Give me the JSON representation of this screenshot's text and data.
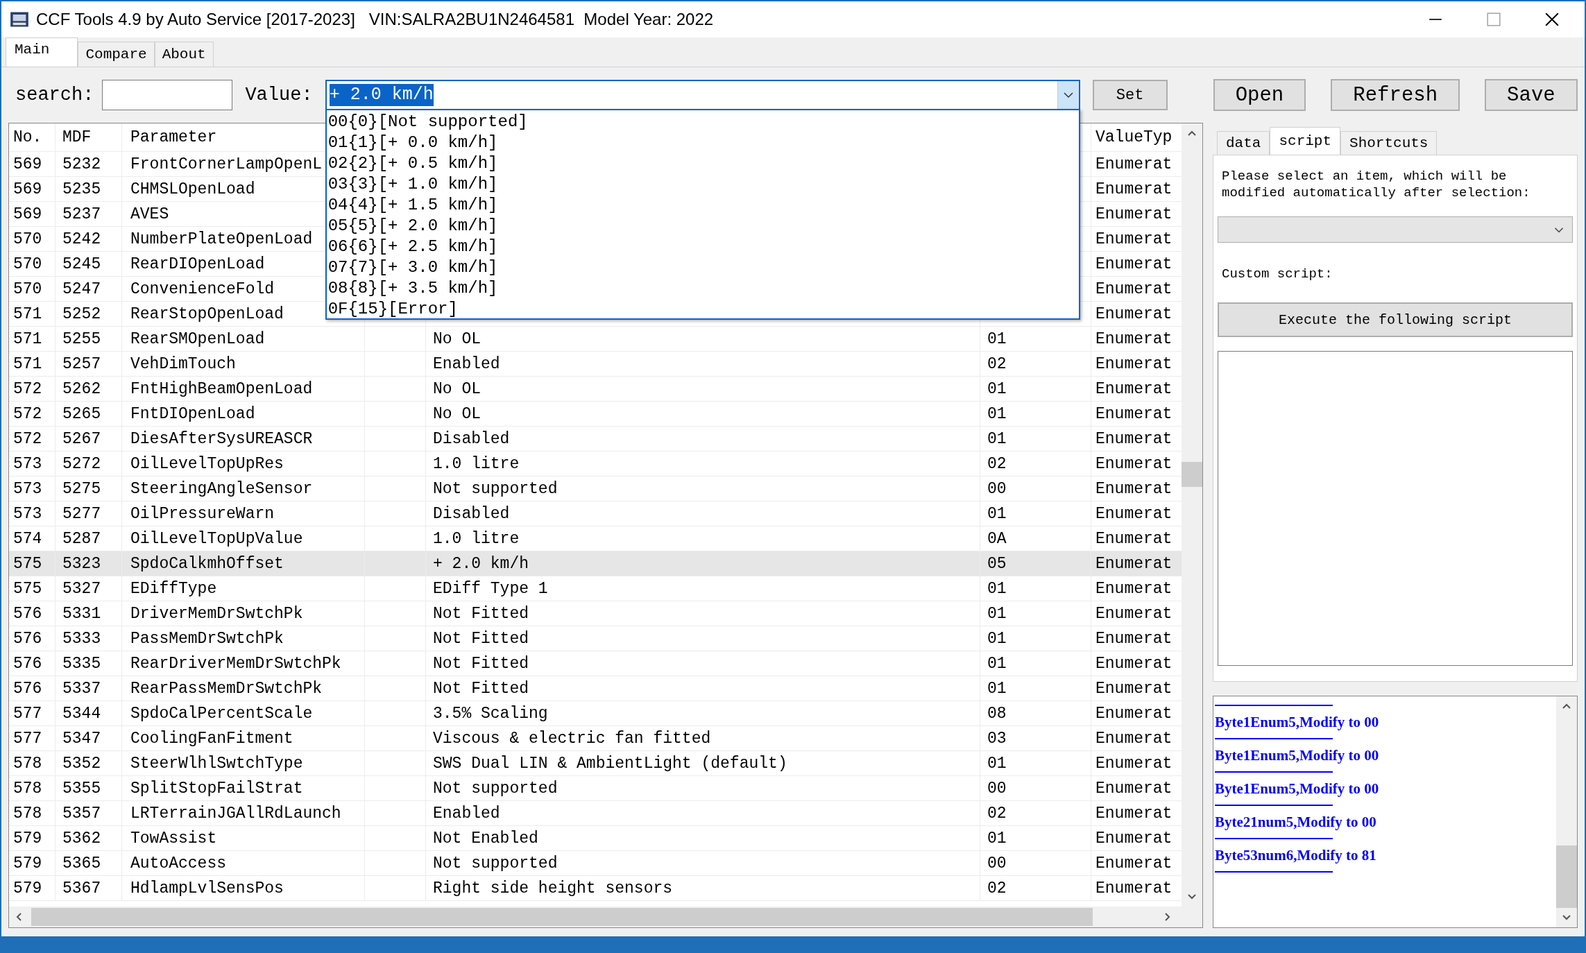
{
  "window": {
    "title": "CCF Tools 4.9 by Auto Service [2017-2023]   VIN:SALRA2BU1N2464581  Model Year: 2022"
  },
  "tabs": [
    {
      "label": "Main",
      "selected": true
    },
    {
      "label": "Compare",
      "selected": false
    },
    {
      "label": "About",
      "selected": false
    }
  ],
  "search": {
    "label": "search:"
  },
  "value_field": {
    "label": "Value:",
    "value": "+ 2.0 km/h",
    "expanded": true,
    "options": [
      {
        "label": "00{0}[Not supported]",
        "selected": false
      },
      {
        "label": "01{1}[+ 0.0 km/h]",
        "selected": false
      },
      {
        "label": "02{2}[+ 0.5 km/h]",
        "selected": false
      },
      {
        "label": "03{3}[+ 1.0 km/h]",
        "selected": false
      },
      {
        "label": "04{4}[+ 1.5 km/h]",
        "selected": false
      },
      {
        "label": "05{5}[+ 2.0 km/h]",
        "selected": false
      },
      {
        "label": "06{6}[+ 2.5 km/h]",
        "selected": false
      },
      {
        "label": "07{7}[+ 3.0 km/h]",
        "selected": false
      },
      {
        "label": "08{8}[+ 3.5 km/h]",
        "selected": false
      },
      {
        "label": "0F{15}[Error]",
        "selected": false
      }
    ]
  },
  "set_button": "Set",
  "file_buttons": [
    "Open",
    "Refresh",
    "Save"
  ],
  "table": {
    "columns": [
      "No.",
      "MDF",
      "Parameter",
      "ValueTyp"
    ],
    "rows": [
      {
        "no": "569",
        "mdf": "5232",
        "parameter": "FrontCornerLampOpenL",
        "value_type": "Enumerat",
        "selected": false
      },
      {
        "no": "569",
        "mdf": "5235",
        "parameter": "CHMSLOpenLoad",
        "value_type": "Enumerat",
        "selected": false
      },
      {
        "no": "569",
        "mdf": "5237",
        "parameter": "AVES",
        "value_type": "Enumerat",
        "selected": false
      },
      {
        "no": "570",
        "mdf": "5242",
        "parameter": "NumberPlateOpenLoad",
        "value_type": "Enumerat",
        "selected": false
      },
      {
        "no": "570",
        "mdf": "5245",
        "parameter": "RearDIOpenLoad",
        "value_type": "Enumerat",
        "selected": false
      },
      {
        "no": "570",
        "mdf": "5247",
        "parameter": "ConvenienceFold",
        "value_type": "Enumerat",
        "selected": false
      },
      {
        "no": "571",
        "mdf": "5252",
        "parameter": "RearStopOpenLoad",
        "value_type": "Enumerat",
        "selected": false
      },
      {
        "no": "571",
        "mdf": "5255",
        "parameter": "RearSMOpenLoad",
        "value": "No OL",
        "hex": "01",
        "value_type": "Enumerat",
        "selected": false
      },
      {
        "no": "571",
        "mdf": "5257",
        "parameter": "VehDimTouch",
        "value": "Enabled",
        "hex": "02",
        "value_type": "Enumerat",
        "selected": false
      },
      {
        "no": "572",
        "mdf": "5262",
        "parameter": "FntHighBeamOpenLoad",
        "value": "No OL",
        "hex": "01",
        "value_type": "Enumerat",
        "selected": false
      },
      {
        "no": "572",
        "mdf": "5265",
        "parameter": "FntDIOpenLoad",
        "value": "No OL",
        "hex": "01",
        "value_type": "Enumerat",
        "selected": false
      },
      {
        "no": "572",
        "mdf": "5267",
        "parameter": "DiesAfterSysUREASCR",
        "value": "Disabled",
        "hex": "01",
        "value_type": "Enumerat",
        "selected": false
      },
      {
        "no": "573",
        "mdf": "5272",
        "parameter": "OilLevelTopUpRes",
        "value": "1.0 litre",
        "hex": "02",
        "value_type": "Enumerat",
        "selected": false
      },
      {
        "no": "573",
        "mdf": "5275",
        "parameter": "SteeringAngleSensor",
        "value": "Not supported",
        "hex": "00",
        "value_type": "Enumerat",
        "selected": false
      },
      {
        "no": "573",
        "mdf": "5277",
        "parameter": "OilPressureWarn",
        "value": "Disabled",
        "hex": "01",
        "value_type": "Enumerat",
        "selected": false
      },
      {
        "no": "574",
        "mdf": "5287",
        "parameter": "OilLevelTopUpValue",
        "value": "1.0 litre",
        "hex": "0A",
        "value_type": "Enumerat",
        "selected": false
      },
      {
        "no": "575",
        "mdf": "5323",
        "parameter": "SpdoCalkmhOffset",
        "value": "+ 2.0 km/h",
        "hex": "05",
        "value_type": "Enumerat",
        "selected": true
      },
      {
        "no": "575",
        "mdf": "5327",
        "parameter": "EDiffType",
        "value": "EDiff Type 1",
        "hex": "01",
        "value_type": "Enumerat",
        "selected": false
      },
      {
        "no": "576",
        "mdf": "5331",
        "parameter": "DriverMemDrSwtchPk",
        "value": "Not Fitted",
        "hex": "01",
        "value_type": "Enumerat",
        "selected": false
      },
      {
        "no": "576",
        "mdf": "5333",
        "parameter": "PassMemDrSwtchPk",
        "value": "Not Fitted",
        "hex": "01",
        "value_type": "Enumerat",
        "selected": false
      },
      {
        "no": "576",
        "mdf": "5335",
        "parameter": "RearDriverMemDrSwtchPk",
        "value": "Not Fitted",
        "hex": "01",
        "value_type": "Enumerat",
        "selected": false
      },
      {
        "no": "576",
        "mdf": "5337",
        "parameter": "RearPassMemDrSwtchPk",
        "value": "Not Fitted",
        "hex": "01",
        "value_type": "Enumerat",
        "selected": false
      },
      {
        "no": "577",
        "mdf": "5344",
        "parameter": "SpdoCalPercentScale",
        "value": "3.5% Scaling",
        "hex": "08",
        "value_type": "Enumerat",
        "selected": false
      },
      {
        "no": "577",
        "mdf": "5347",
        "parameter": "CoolingFanFitment",
        "value": "Viscous & electric fan fitted",
        "hex": "03",
        "value_type": "Enumerat",
        "selected": false
      },
      {
        "no": "578",
        "mdf": "5352",
        "parameter": "SteerWlhlSwtchType",
        "value": "SWS Dual LIN & AmbientLight (default)",
        "hex": "01",
        "value_type": "Enumerat",
        "selected": false
      },
      {
        "no": "578",
        "mdf": "5355",
        "parameter": "SplitStopFailStrat",
        "value": "Not supported",
        "hex": "00",
        "value_type": "Enumerat",
        "selected": false
      },
      {
        "no": "578",
        "mdf": "5357",
        "parameter": "LRTerrainJGAllRdLaunch",
        "value": "Enabled",
        "hex": "02",
        "value_type": "Enumerat",
        "selected": false
      },
      {
        "no": "579",
        "mdf": "5362",
        "parameter": "TowAssist",
        "value": "Not Enabled",
        "hex": "01",
        "value_type": "Enumerat",
        "selected": false
      },
      {
        "no": "579",
        "mdf": "5365",
        "parameter": "AutoAccess",
        "value": "Not supported",
        "hex": "00",
        "value_type": "Enumerat",
        "selected": false
      },
      {
        "no": "579",
        "mdf": "5367",
        "parameter": "HdlampLvlSensPos",
        "value": "Right side height sensors",
        "hex": "02",
        "value_type": "Enumerat",
        "selected": false
      }
    ]
  },
  "side_tabs": [
    {
      "label": "data",
      "selected": false
    },
    {
      "label": "script",
      "selected": true
    },
    {
      "label": "Shortcuts",
      "selected": false
    }
  ],
  "script_panel": {
    "instruction": "Please select an item, which will be modified automatically after selection:",
    "custom_label": "Custom script:",
    "execute_button": "Execute the following script"
  },
  "log": [
    "Byte1Enum5,Modify to 00",
    "Byte1Enum5,Modify to 00",
    "Byte1Enum5,Modify to 00",
    "Byte21num5,Modify to 00",
    "Byte53num6,Modify to 81"
  ]
}
